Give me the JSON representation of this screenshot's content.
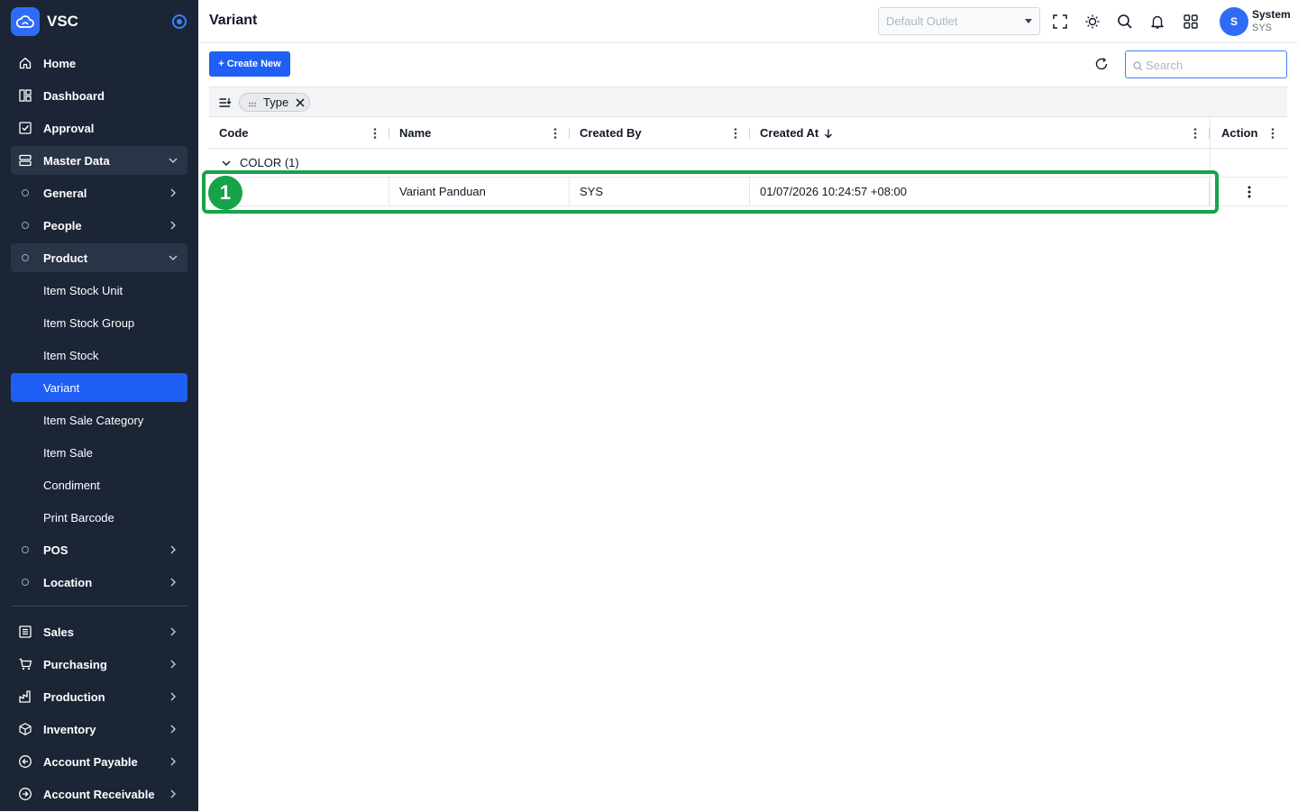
{
  "brand": {
    "name": "VSC"
  },
  "sidebar": {
    "items": [
      {
        "label": "Home"
      },
      {
        "label": "Dashboard"
      },
      {
        "label": "Approval"
      },
      {
        "label": "Master Data"
      },
      {
        "label": "General"
      },
      {
        "label": "People"
      },
      {
        "label": "Product"
      },
      {
        "label": "Item Stock Unit"
      },
      {
        "label": "Item Stock Group"
      },
      {
        "label": "Item Stock"
      },
      {
        "label": "Variant"
      },
      {
        "label": "Item Sale Category"
      },
      {
        "label": "Item Sale"
      },
      {
        "label": "Condiment"
      },
      {
        "label": "Print Barcode"
      },
      {
        "label": "POS"
      },
      {
        "label": "Location"
      },
      {
        "label": "Sales"
      },
      {
        "label": "Purchasing"
      },
      {
        "label": "Production"
      },
      {
        "label": "Inventory"
      },
      {
        "label": "Account Payable"
      },
      {
        "label": "Account Receivable"
      }
    ]
  },
  "header": {
    "title": "Variant",
    "outlet_placeholder": "Default Outlet",
    "user": {
      "initial": "S",
      "name": "System",
      "code": "SYS"
    }
  },
  "toolbar": {
    "create_label": "+ Create New",
    "search_placeholder": "Search"
  },
  "grouping": {
    "chip_label": "Type"
  },
  "table": {
    "columns": [
      "Code",
      "Name",
      "Created By",
      "Created At",
      "Action"
    ],
    "group_label": "COLOR (1)",
    "rows": [
      {
        "code": "",
        "name": "Variant Panduan",
        "created_by": "SYS",
        "created_at": "01/07/2026 10:24:57 +08:00"
      }
    ]
  },
  "annotation": {
    "badge": "1"
  },
  "colors": {
    "sidebar_bg": "#1b2536",
    "accent": "#1f5ff5",
    "highlight": "#16a34a"
  }
}
